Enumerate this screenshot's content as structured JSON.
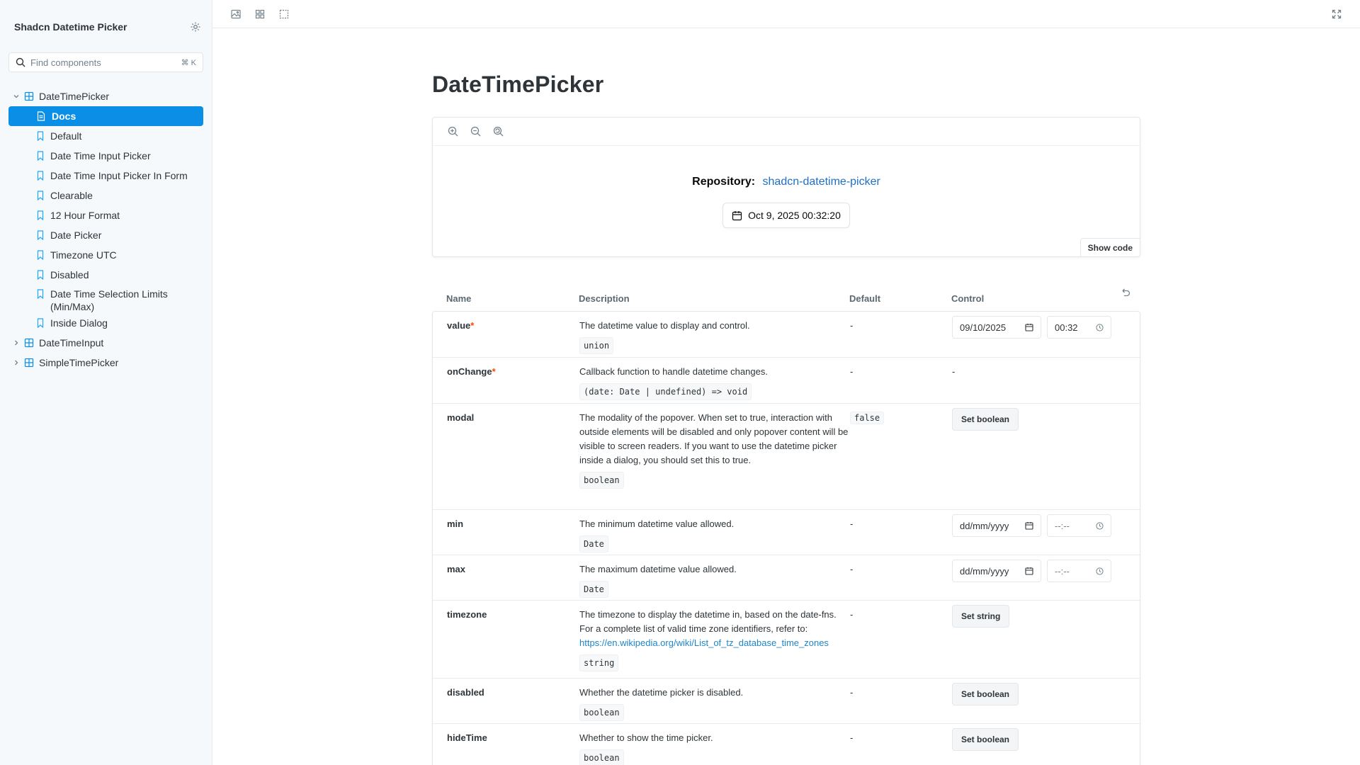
{
  "sidebar": {
    "title": "Shadcn Datetime Picker",
    "search_placeholder": "Find components",
    "search_shortcut": "⌘ K",
    "groups": [
      {
        "label": "DateTimePicker",
        "expanded": true,
        "items": [
          {
            "label": "Docs",
            "active": true
          },
          {
            "label": "Default"
          },
          {
            "label": "Date Time Input Picker"
          },
          {
            "label": "Date Time Input Picker In Form"
          },
          {
            "label": "Clearable"
          },
          {
            "label": "12 Hour Format"
          },
          {
            "label": "Date Picker"
          },
          {
            "label": "Timezone UTC"
          },
          {
            "label": "Disabled"
          },
          {
            "label": "Date Time Selection Limits (Min/Max)"
          },
          {
            "label": "Inside Dialog"
          }
        ]
      },
      {
        "label": "DateTimeInput",
        "expanded": false
      },
      {
        "label": "SimpleTimePicker",
        "expanded": false
      }
    ]
  },
  "page": {
    "title": "DateTimePicker"
  },
  "preview": {
    "repo_label": "Repository:",
    "repo_link": "shadcn-datetime-picker",
    "datetime_value": "Oct 9, 2025 00:32:20",
    "show_code": "Show code"
  },
  "args_table": {
    "headers": {
      "name": "Name",
      "description": "Description",
      "default": "Default",
      "control": "Control"
    },
    "rows": [
      {
        "name": "value",
        "required": "*",
        "description": "The datetime value to display and control.",
        "type": "union",
        "default": "-",
        "date": "09/10/2025",
        "time": "00:32"
      },
      {
        "name": "onChange",
        "required": "*",
        "description": "Callback function to handle datetime changes.",
        "type": "(date: Date | undefined) => void",
        "default": "-",
        "control_text": "-"
      },
      {
        "name": "modal",
        "description": "The modality of the popover. When set to true, interaction with outside elements will be disabled and only popover content will be visible to screen readers. If you want to use the datetime picker inside a dialog, you should set this to true.",
        "type": "boolean",
        "default": "false",
        "button": "Set boolean"
      },
      {
        "name": "min",
        "description": "The minimum datetime value allowed.",
        "type": "Date",
        "default": "-",
        "date": "dd/mm/yyyy",
        "time": "--:--"
      },
      {
        "name": "max",
        "description": "The maximum datetime value allowed.",
        "type": "Date",
        "default": "-",
        "date": "dd/mm/yyyy",
        "time": "--:--"
      },
      {
        "name": "timezone",
        "description": "The timezone to display the datetime in, based on the date-fns. For a complete list of valid time zone identifiers, refer to:",
        "link": "https://en.wikipedia.org/wiki/List_of_tz_database_time_zones",
        "type": "string",
        "default": "-",
        "button": "Set string"
      },
      {
        "name": "disabled",
        "description": "Whether the datetime picker is disabled.",
        "type": "boolean",
        "default": "-",
        "button": "Set boolean"
      },
      {
        "name": "hideTime",
        "description": "Whether to show the time picker.",
        "type": "boolean",
        "default": "-",
        "button": "Set boolean"
      }
    ]
  },
  "colors": {
    "accent": "#0b8fe6",
    "required": "#ff4400",
    "link": "#1f6fc5"
  },
  "icons": {
    "toolbar": [
      "image-icon",
      "grid-icon",
      "outline-icon"
    ],
    "toolbar_right": "fullscreen-icon",
    "preview": [
      "zoom-in-icon",
      "zoom-out-icon",
      "reset-zoom-icon"
    ]
  }
}
